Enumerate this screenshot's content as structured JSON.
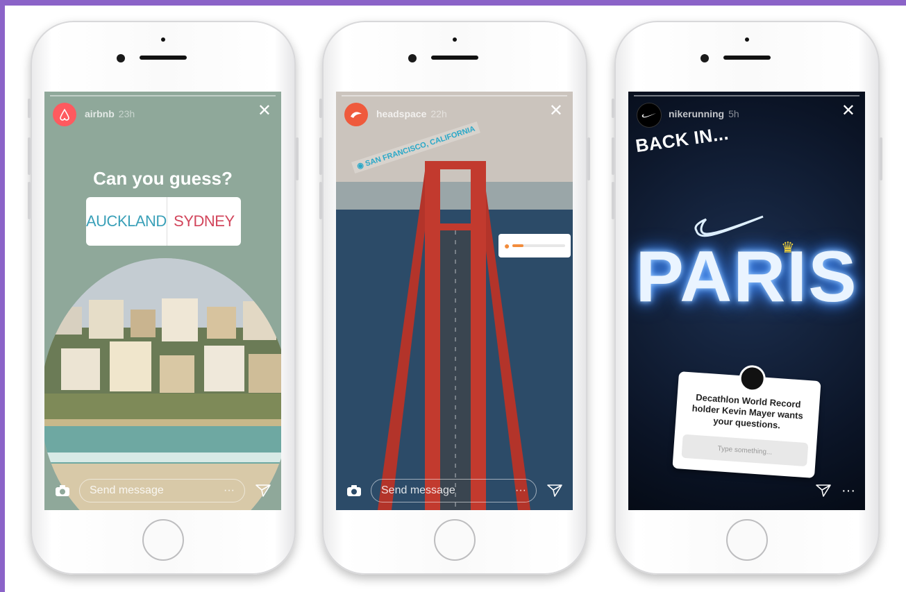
{
  "colors": {
    "frame": "#8b63c8",
    "airbnb": "#ff5a5f",
    "headspace": "#ef5a3c",
    "nike": "#000000"
  },
  "phones": [
    {
      "username": "airbnb",
      "time": "23h",
      "poll_question": "Can you guess?",
      "poll_options": [
        "AUCKLAND",
        "SYDNEY"
      ],
      "reply_placeholder": "Send message",
      "more": "···"
    },
    {
      "username": "headspace",
      "time": "22h",
      "location_sticker": "SAN FRANCISCO, CALIFORNIA",
      "slider_value": 0.2,
      "reply_placeholder": "Send message",
      "more": "···"
    },
    {
      "username": "nikerunning",
      "time": "5h",
      "headline": "BACK IN...",
      "neon_word": "PARIS",
      "question_prompt": "Decathlon World Record holder Kevin Mayer wants your questions.",
      "question_input_placeholder": "Type something...",
      "more": "···"
    }
  ],
  "icons": {
    "camera": "camera-icon",
    "direct": "direct-send-icon",
    "close": "close-icon",
    "more": "more-dots-icon"
  }
}
